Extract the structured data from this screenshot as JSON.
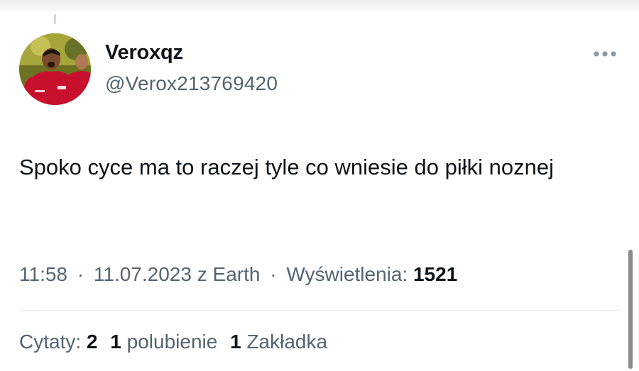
{
  "tweet": {
    "author": {
      "display_name": "Veroxqz",
      "handle": "@Verox213769420"
    },
    "text": "Spoko cyce ma to raczej tyle co wniesie do piłki noznej",
    "meta": {
      "time": "11:58",
      "separator": "·",
      "date": "11.07.2023",
      "source": "z Earth",
      "views_label": "Wyświetlenia:",
      "views_count": "1521"
    },
    "stats": {
      "quotes_label": "Cytaty:",
      "quotes_count": "2",
      "likes_count": "1",
      "likes_label": "polubienie",
      "bookmarks_count": "1",
      "bookmarks_label": "Zakładka"
    }
  },
  "icons": {
    "more": "more-horizontal-icon",
    "avatar": "profile-photo"
  },
  "colors": {
    "text_primary": "#0f1419",
    "text_secondary": "#536471",
    "divider": "#e6ecf0",
    "avatar_shirt": "#c8102e"
  }
}
